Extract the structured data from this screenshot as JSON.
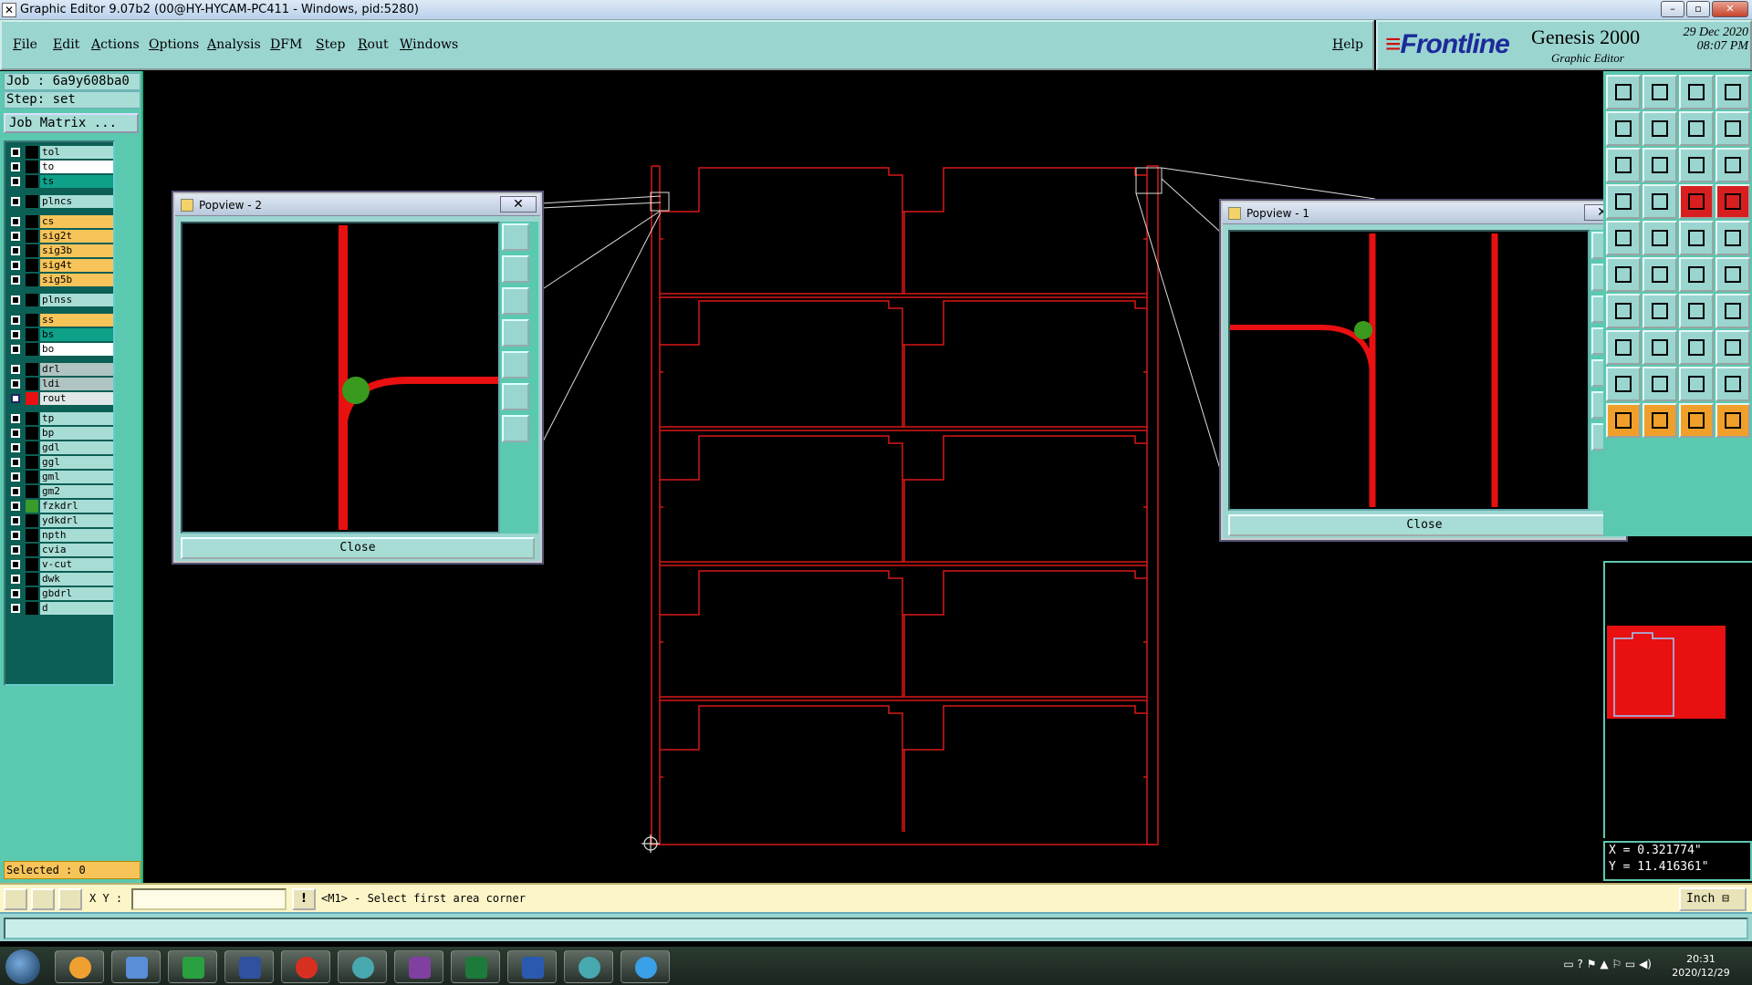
{
  "window": {
    "title": "Graphic Editor 9.07b2 (00@HY-HYCAM-PC411 - Windows, pid:5280)"
  },
  "menu": {
    "items": [
      "File",
      "Edit",
      "Actions",
      "Options",
      "Analysis",
      "DFM",
      "Step",
      "Rout",
      "Windows"
    ],
    "help": "Help"
  },
  "brand": {
    "logo": "Frontline",
    "product": "Genesis 2000",
    "subtitle": "Graphic Editor",
    "date": "29 Dec 2020",
    "time": "08:07 PM"
  },
  "job": {
    "job_line": "Job : 6a9y608ba0",
    "step_line": "Step: set",
    "matrix_button": "Job Matrix ..."
  },
  "layers": [
    {
      "name": "tol",
      "color": "#a8ddd6"
    },
    {
      "name": "to",
      "color": "#ffffff"
    },
    {
      "name": "ts",
      "color": "#0fa08a"
    },
    {
      "name": "plncs",
      "color": "#a8ddd6"
    },
    {
      "name": "cs",
      "color": "#f7c45a"
    },
    {
      "name": "sig2t",
      "color": "#f7c45a"
    },
    {
      "name": "sig3b",
      "color": "#f7c45a"
    },
    {
      "name": "sig4t",
      "color": "#f7c45a"
    },
    {
      "name": "sig5b",
      "color": "#f7c45a"
    },
    {
      "name": "plnss",
      "color": "#a8ddd6"
    },
    {
      "name": "ss",
      "color": "#f7c45a"
    },
    {
      "name": "bs",
      "color": "#0fa08a"
    },
    {
      "name": "bo",
      "color": "#ffffff"
    },
    {
      "name": "drl",
      "color": "#b0c4c2"
    },
    {
      "name": "ldi",
      "color": "#b0c4c2"
    },
    {
      "name": "rout",
      "color": "#dfe8e6",
      "swatch": "#e81010",
      "active": true
    },
    {
      "name": "tp",
      "color": "#a8ddd6"
    },
    {
      "name": "bp",
      "color": "#a8ddd6"
    },
    {
      "name": "gdl",
      "color": "#a8ddd6"
    },
    {
      "name": "ggl",
      "color": "#a8ddd6"
    },
    {
      "name": "gml",
      "color": "#a8ddd6"
    },
    {
      "name": "gm2",
      "color": "#a8ddd6"
    },
    {
      "name": "fzkdrl",
      "color": "#a8ddd6",
      "swatch": "#3a9a2a"
    },
    {
      "name": "ydkdrl",
      "color": "#a8ddd6"
    },
    {
      "name": "npth",
      "color": "#a8ddd6"
    },
    {
      "name": "cvia",
      "color": "#a8ddd6"
    },
    {
      "name": "v-cut",
      "color": "#a8ddd6"
    },
    {
      "name": "dwk",
      "color": "#a8ddd6"
    },
    {
      "name": "gbdrl",
      "color": "#a8ddd6"
    },
    {
      "name": "d",
      "color": "#a8ddd6"
    }
  ],
  "selected": "Selected : 0",
  "popview2": {
    "title": "Popview - 2",
    "close": "Close"
  },
  "popview1": {
    "title": "Popview - 1",
    "close": "Close"
  },
  "coords": {
    "x": "X = 0.321774\"",
    "y": "Y = 11.416361\""
  },
  "command": {
    "xy_label": "X Y :",
    "xy_value": "",
    "prompt": "<M1> - Select first area corner",
    "unit": "Inch"
  },
  "taskbar": {
    "time": "20:31",
    "date": "2020/12/29"
  },
  "colors": {
    "panel": "#5bc8b0",
    "menu": "#9bd5d0",
    "rout": "#d81818"
  }
}
